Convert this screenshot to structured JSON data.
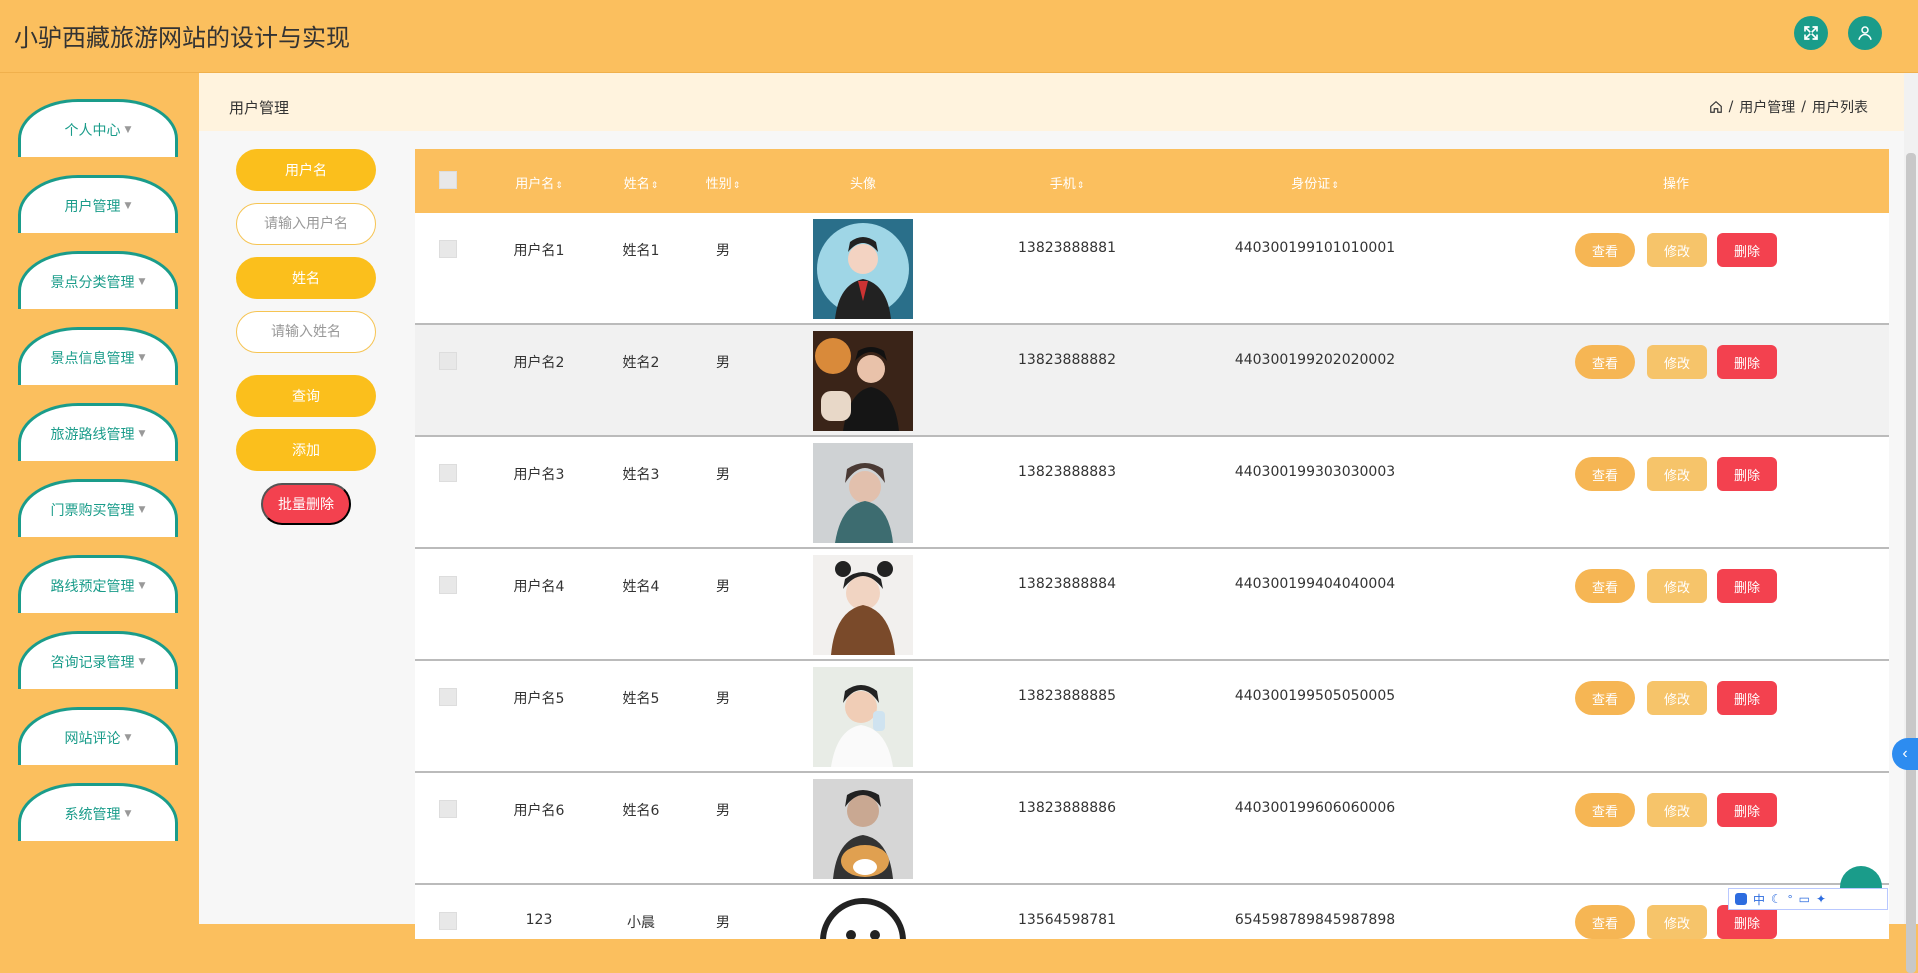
{
  "app": {
    "title": "小驴西藏旅游网站的设计与实现"
  },
  "header": {
    "fullscreen_icon": "fullscreen-icon",
    "user_icon": "user-icon"
  },
  "sidebar": {
    "items": [
      {
        "label": "个人中心"
      },
      {
        "label": "用户管理"
      },
      {
        "label": "景点分类管理"
      },
      {
        "label": "景点信息管理"
      },
      {
        "label": "旅游路线管理"
      },
      {
        "label": "门票购买管理"
      },
      {
        "label": "路线预定管理"
      },
      {
        "label": "咨询记录管理"
      },
      {
        "label": "网站评论"
      },
      {
        "label": "系统管理"
      }
    ]
  },
  "page": {
    "title": "用户管理",
    "breadcrumb": {
      "home_icon": "home-icon",
      "level1": "用户管理",
      "level2": "用户列表",
      "separator": "/"
    }
  },
  "filter": {
    "username_label": "用户名",
    "username_placeholder": "请输入用户名",
    "name_label": "姓名",
    "name_placeholder": "请输入姓名",
    "query_button": "查询",
    "add_button": "添加",
    "batch_delete_button": "批量删除"
  },
  "table": {
    "columns": {
      "username": "用户名",
      "name": "姓名",
      "gender": "性别",
      "avatar": "头像",
      "phone": "手机",
      "id_card": "身份证",
      "actions": "操作"
    },
    "sort_glyph": "⇕",
    "actions": {
      "view": "查看",
      "edit": "修改",
      "delete": "删除"
    },
    "rows": [
      {
        "username": "用户名1",
        "name": "姓名1",
        "gender": "男",
        "phone": "13823888881",
        "id_card": "440300199101010001"
      },
      {
        "username": "用户名2",
        "name": "姓名2",
        "gender": "男",
        "phone": "13823888882",
        "id_card": "440300199202020002"
      },
      {
        "username": "用户名3",
        "name": "姓名3",
        "gender": "男",
        "phone": "13823888883",
        "id_card": "440300199303030003"
      },
      {
        "username": "用户名4",
        "name": "姓名4",
        "gender": "男",
        "phone": "13823888884",
        "id_card": "440300199404040004"
      },
      {
        "username": "用户名5",
        "name": "姓名5",
        "gender": "男",
        "phone": "13823888885",
        "id_card": "440300199505050005"
      },
      {
        "username": "用户名6",
        "name": "姓名6",
        "gender": "男",
        "phone": "13823888886",
        "id_card": "440300199606060006"
      },
      {
        "username": "123",
        "name": "小晨",
        "gender": "男",
        "phone": "13564598781",
        "id_card": "654598789845987898"
      }
    ]
  },
  "ime_toolbar": {
    "lang": "中"
  },
  "colors": {
    "accent": "#fbbf5e",
    "teal": "#1a9c8a",
    "danger": "#f3414f",
    "pill": "#fbbf1c"
  }
}
